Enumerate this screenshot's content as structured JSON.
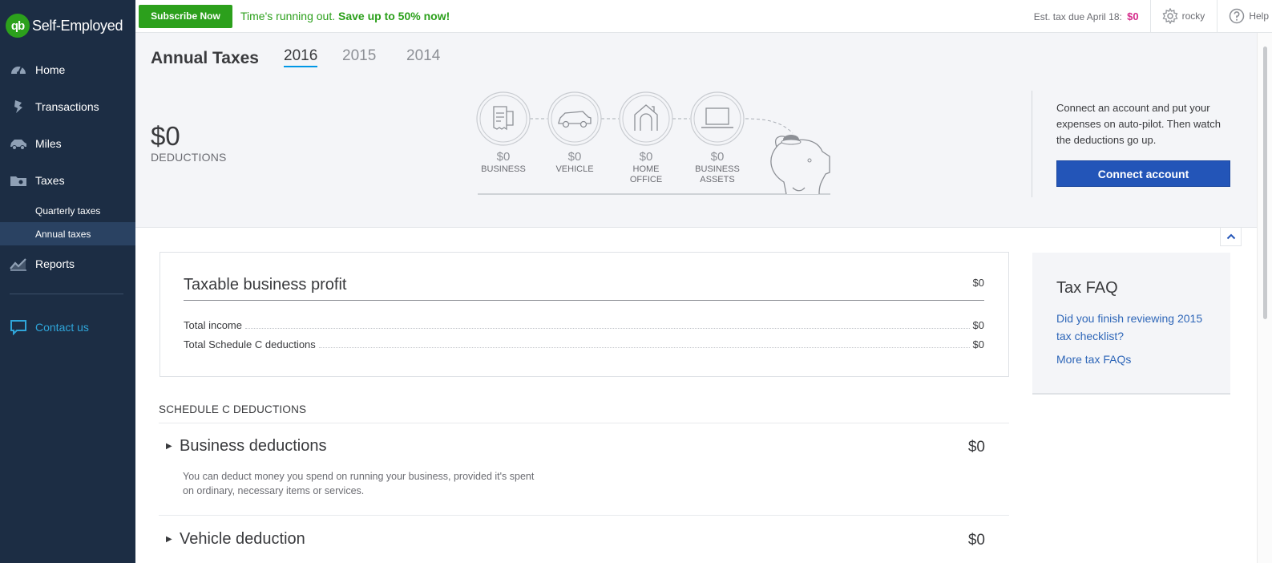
{
  "brand": {
    "logo": "qb",
    "name": "Self-Employed"
  },
  "sidebar": {
    "items": [
      {
        "label": "Home",
        "icon": "dashboard-icon"
      },
      {
        "label": "Transactions",
        "icon": "transactions-icon"
      },
      {
        "label": "Miles",
        "icon": "car-icon"
      },
      {
        "label": "Taxes",
        "icon": "taxes-icon"
      }
    ],
    "subitems": [
      {
        "label": "Quarterly taxes"
      },
      {
        "label": "Annual taxes",
        "active": true
      }
    ],
    "reports": {
      "label": "Reports",
      "icon": "chart-line-icon"
    },
    "contact": {
      "label": "Contact us",
      "icon": "chat-icon"
    }
  },
  "topbar": {
    "subscribe_label": "Subscribe Now",
    "promo_text": "Time's running out. ",
    "promo_bold": "Save up to 50% now!",
    "est_tax_label": "Est. tax due April 18:",
    "est_tax_value": "$0",
    "user_name": "rocky",
    "help_label": "Help"
  },
  "header": {
    "title": "Annual Taxes",
    "years": [
      "2016",
      "2015",
      "2014"
    ],
    "active_year": "2016",
    "deductions_total": "$0",
    "deductions_label": "DEDUCTIONS",
    "categories": [
      {
        "value": "$0",
        "label": "BUSINESS",
        "icon": "receipt-icon"
      },
      {
        "value": "$0",
        "label": "VEHICLE",
        "icon": "car-icon"
      },
      {
        "value": "$0",
        "label": "HOME OFFICE",
        "icon": "house-icon"
      },
      {
        "value": "$0",
        "label": "BUSINESS ASSETS",
        "icon": "laptop-icon"
      }
    ],
    "connect_text": "Connect an account and put your expenses on auto-pilot. Then watch the deductions go up.",
    "connect_button": "Connect account"
  },
  "profit": {
    "title": "Taxable business profit",
    "value": "$0",
    "lines": [
      {
        "label": "Total income",
        "value": "$0"
      },
      {
        "label": "Total Schedule C deductions",
        "value": "$0"
      }
    ]
  },
  "schedule_c": {
    "heading": "SCHEDULE C DEDUCTIONS",
    "rows": [
      {
        "title": "Business deductions",
        "value": "$0",
        "description": "You can deduct money you spend on running your business, provided it's spent on ordinary, necessary items or services."
      },
      {
        "title": "Vehicle deduction",
        "value": "$0"
      }
    ]
  },
  "faq": {
    "title": "Tax FAQ",
    "link1": "Did you finish reviewing 2015 tax checklist?",
    "link2": "More tax FAQs"
  },
  "colors": {
    "sidebar_bg": "#1c2d44",
    "brand_green": "#2ca01c",
    "accent_blue": "#2355b8",
    "tax_pink": "#d52b8b",
    "link_blue": "#2e66b8",
    "contact_cyan": "#2fa5d9"
  }
}
